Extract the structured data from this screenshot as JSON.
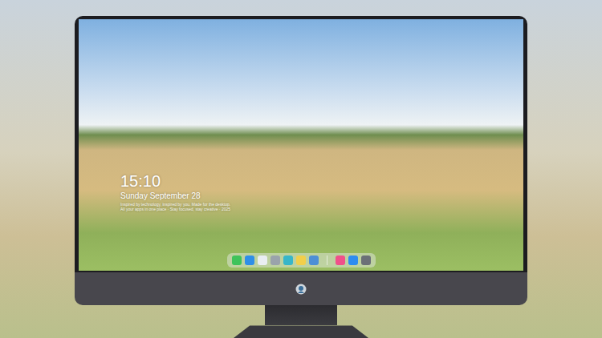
{
  "desktop": {
    "clock": {
      "time": "15:10",
      "date": "Sunday September 28",
      "caption": [
        "Inspired by technology, inspired by you. Made for the desktop.",
        "All your apps in one place · Stay focused, stay creative · 2025"
      ]
    },
    "dock": {
      "items": [
        {
          "kind": "app",
          "color": "#3fc35a"
        },
        {
          "kind": "app",
          "color": "#2f8fe8"
        },
        {
          "kind": "app",
          "color": "#e9eef2"
        },
        {
          "kind": "app",
          "color": "#9aa3ab"
        },
        {
          "kind": "app",
          "color": "#38b6c9"
        },
        {
          "kind": "app",
          "color": "#f2cf4a"
        },
        {
          "kind": "app",
          "color": "#4d8fd6"
        },
        {
          "kind": "divider"
        },
        {
          "kind": "app",
          "color": "#f0508a"
        },
        {
          "kind": "app",
          "color": "#2d8cf0"
        },
        {
          "kind": "app",
          "color": "#6b7077"
        }
      ]
    }
  }
}
